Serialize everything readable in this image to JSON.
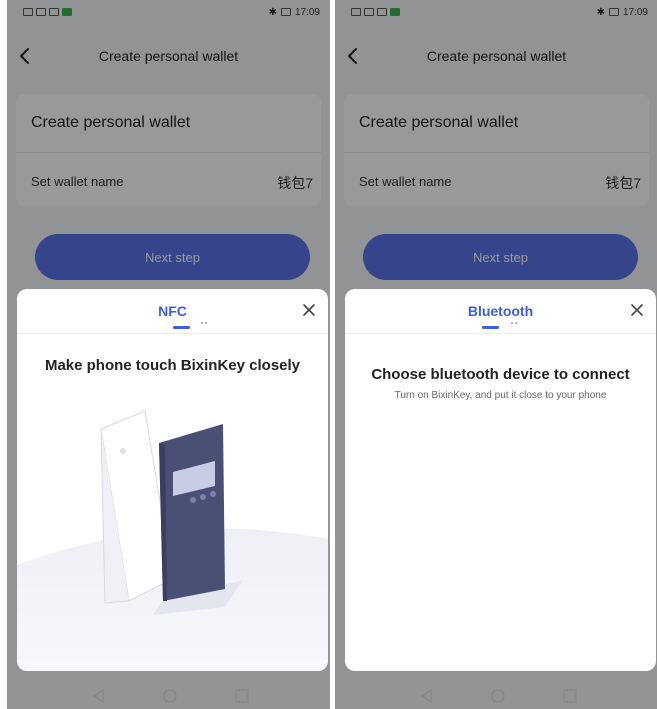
{
  "status_bar": {
    "time": "17:09"
  },
  "screens": [
    {
      "header": {
        "title": "Create personal wallet"
      },
      "card": {
        "title": "Create personal wallet",
        "name_label": "Set wallet name",
        "name_value": "钱包7"
      },
      "next_button": {
        "label": "Next step"
      },
      "sheet": {
        "tab_label": "NFC",
        "heading": "Make phone touch BixinKey closely"
      }
    },
    {
      "header": {
        "title": "Create personal wallet"
      },
      "card": {
        "title": "Create personal wallet",
        "name_label": "Set wallet name",
        "name_value": "钱包7"
      },
      "next_button": {
        "label": "Next step"
      },
      "sheet": {
        "tab_label": "Bluetooth",
        "heading": "Choose bluetooth device to connect",
        "subtext": "Turn on BixinKey, and put it close to your phone"
      }
    }
  ],
  "colors": {
    "accent": "#3d5ce6",
    "button": "#5b74e8",
    "device": "#4a5075"
  },
  "icons": [
    "back-icon",
    "close-icon",
    "nfc-illustration",
    "nav-back-icon",
    "nav-home-icon",
    "nav-recents-icon"
  ]
}
